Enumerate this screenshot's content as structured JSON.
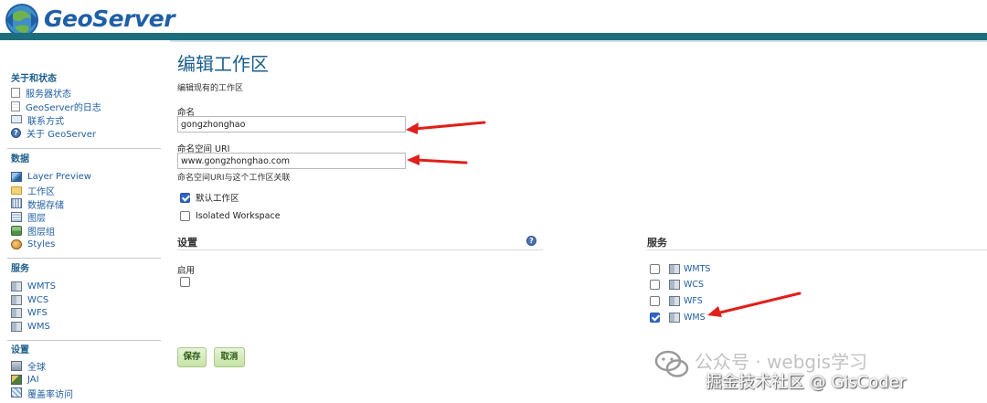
{
  "header": {
    "brand": "GeoServer"
  },
  "sidebar": {
    "sections": [
      {
        "title": "关于和状态",
        "items": [
          {
            "label": "服务器状态",
            "icon": "server-status-icon"
          },
          {
            "label": "GeoServer的日志",
            "icon": "log-icon"
          },
          {
            "label": "联系方式",
            "icon": "contact-icon"
          },
          {
            "label": "关于 GeoServer",
            "icon": "about-icon"
          }
        ]
      },
      {
        "title": "数据",
        "items": [
          {
            "label": "Layer Preview",
            "icon": "layer-preview-icon"
          },
          {
            "label": "工作区",
            "icon": "workspace-icon"
          },
          {
            "label": "数据存储",
            "icon": "datastore-icon"
          },
          {
            "label": "图层",
            "icon": "layer-icon"
          },
          {
            "label": "图层组",
            "icon": "layergroup-icon"
          },
          {
            "label": "Styles",
            "icon": "styles-icon"
          }
        ]
      },
      {
        "title": "服务",
        "items": [
          {
            "label": "WMTS",
            "icon": "wmts-icon"
          },
          {
            "label": "WCS",
            "icon": "wcs-icon"
          },
          {
            "label": "WFS",
            "icon": "wfs-icon"
          },
          {
            "label": "WMS",
            "icon": "wms-icon"
          }
        ]
      },
      {
        "title": "设置",
        "items": [
          {
            "label": "全球",
            "icon": "global-icon"
          },
          {
            "label": "JAI",
            "icon": "jai-icon"
          },
          {
            "label": "覆盖率访问",
            "icon": "coverage-access-icon"
          }
        ]
      }
    ]
  },
  "main": {
    "title": "编辑工作区",
    "subtitle": "编辑现有的工作区",
    "name_label": "命名",
    "name_value": "gongzhonghao",
    "uri_label": "命名空间 URI",
    "uri_value": "www.gongzhonghao.com",
    "uri_hint": "命名空间URI与这个工作区关联",
    "default_workspace": {
      "label": "默认工作区",
      "checked": true
    },
    "isolated_workspace": {
      "label": "Isolated Workspace",
      "checked": false
    },
    "settings": {
      "title": "设置",
      "enabled_label": "启用",
      "enabled": false
    },
    "services": {
      "title": "服务",
      "items": [
        {
          "label": "WMTS",
          "checked": false
        },
        {
          "label": "WCS",
          "checked": false
        },
        {
          "label": "WFS",
          "checked": false
        },
        {
          "label": "WMS",
          "checked": true
        }
      ]
    },
    "save_label": "保存",
    "cancel_label": "取消"
  },
  "watermark": {
    "line1": "公众号 · webgis学习",
    "line2": "掘金技术社区 @ GisCoder"
  },
  "colors": {
    "accent": "#1c6e7d",
    "link": "#1e5ea0",
    "title": "#1c5e8c",
    "arrow": "#e0201a",
    "button": "#c6e2a5"
  }
}
